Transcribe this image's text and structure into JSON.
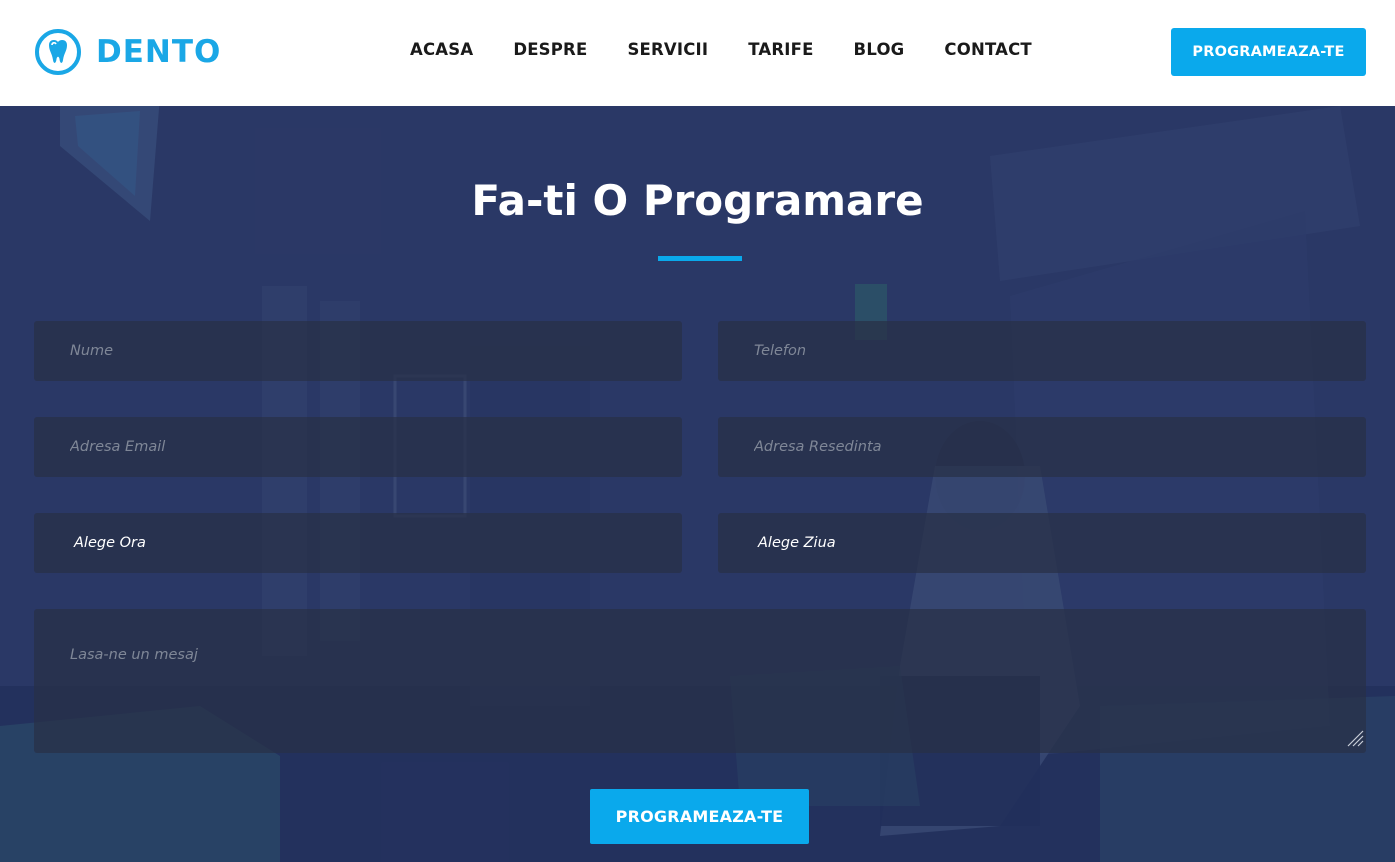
{
  "brand": {
    "name": "DENTO",
    "color": "#1aa7e6",
    "logo_icon": "tooth-circle-icon"
  },
  "nav": {
    "items": [
      {
        "label": "ACASA"
      },
      {
        "label": "DESPRE"
      },
      {
        "label": "SERVICII"
      },
      {
        "label": "TARIFE"
      },
      {
        "label": "BLOG"
      },
      {
        "label": "CONTACT"
      }
    ]
  },
  "header": {
    "cta_label": "PROGRAMEAZA-TE"
  },
  "form": {
    "title": "Fa-ti O Programare",
    "accent": "#0aa9ec",
    "name_placeholder": "Nume",
    "phone_placeholder": "Telefon",
    "email_placeholder": "Adresa Email",
    "address_placeholder": "Adresa Resedinta",
    "hour_select": "Alege Ora",
    "day_select": "Alege Ziua",
    "message_placeholder": "Lasa-ne un mesaj",
    "submit_label": "PROGRAMEAZA-TE"
  }
}
